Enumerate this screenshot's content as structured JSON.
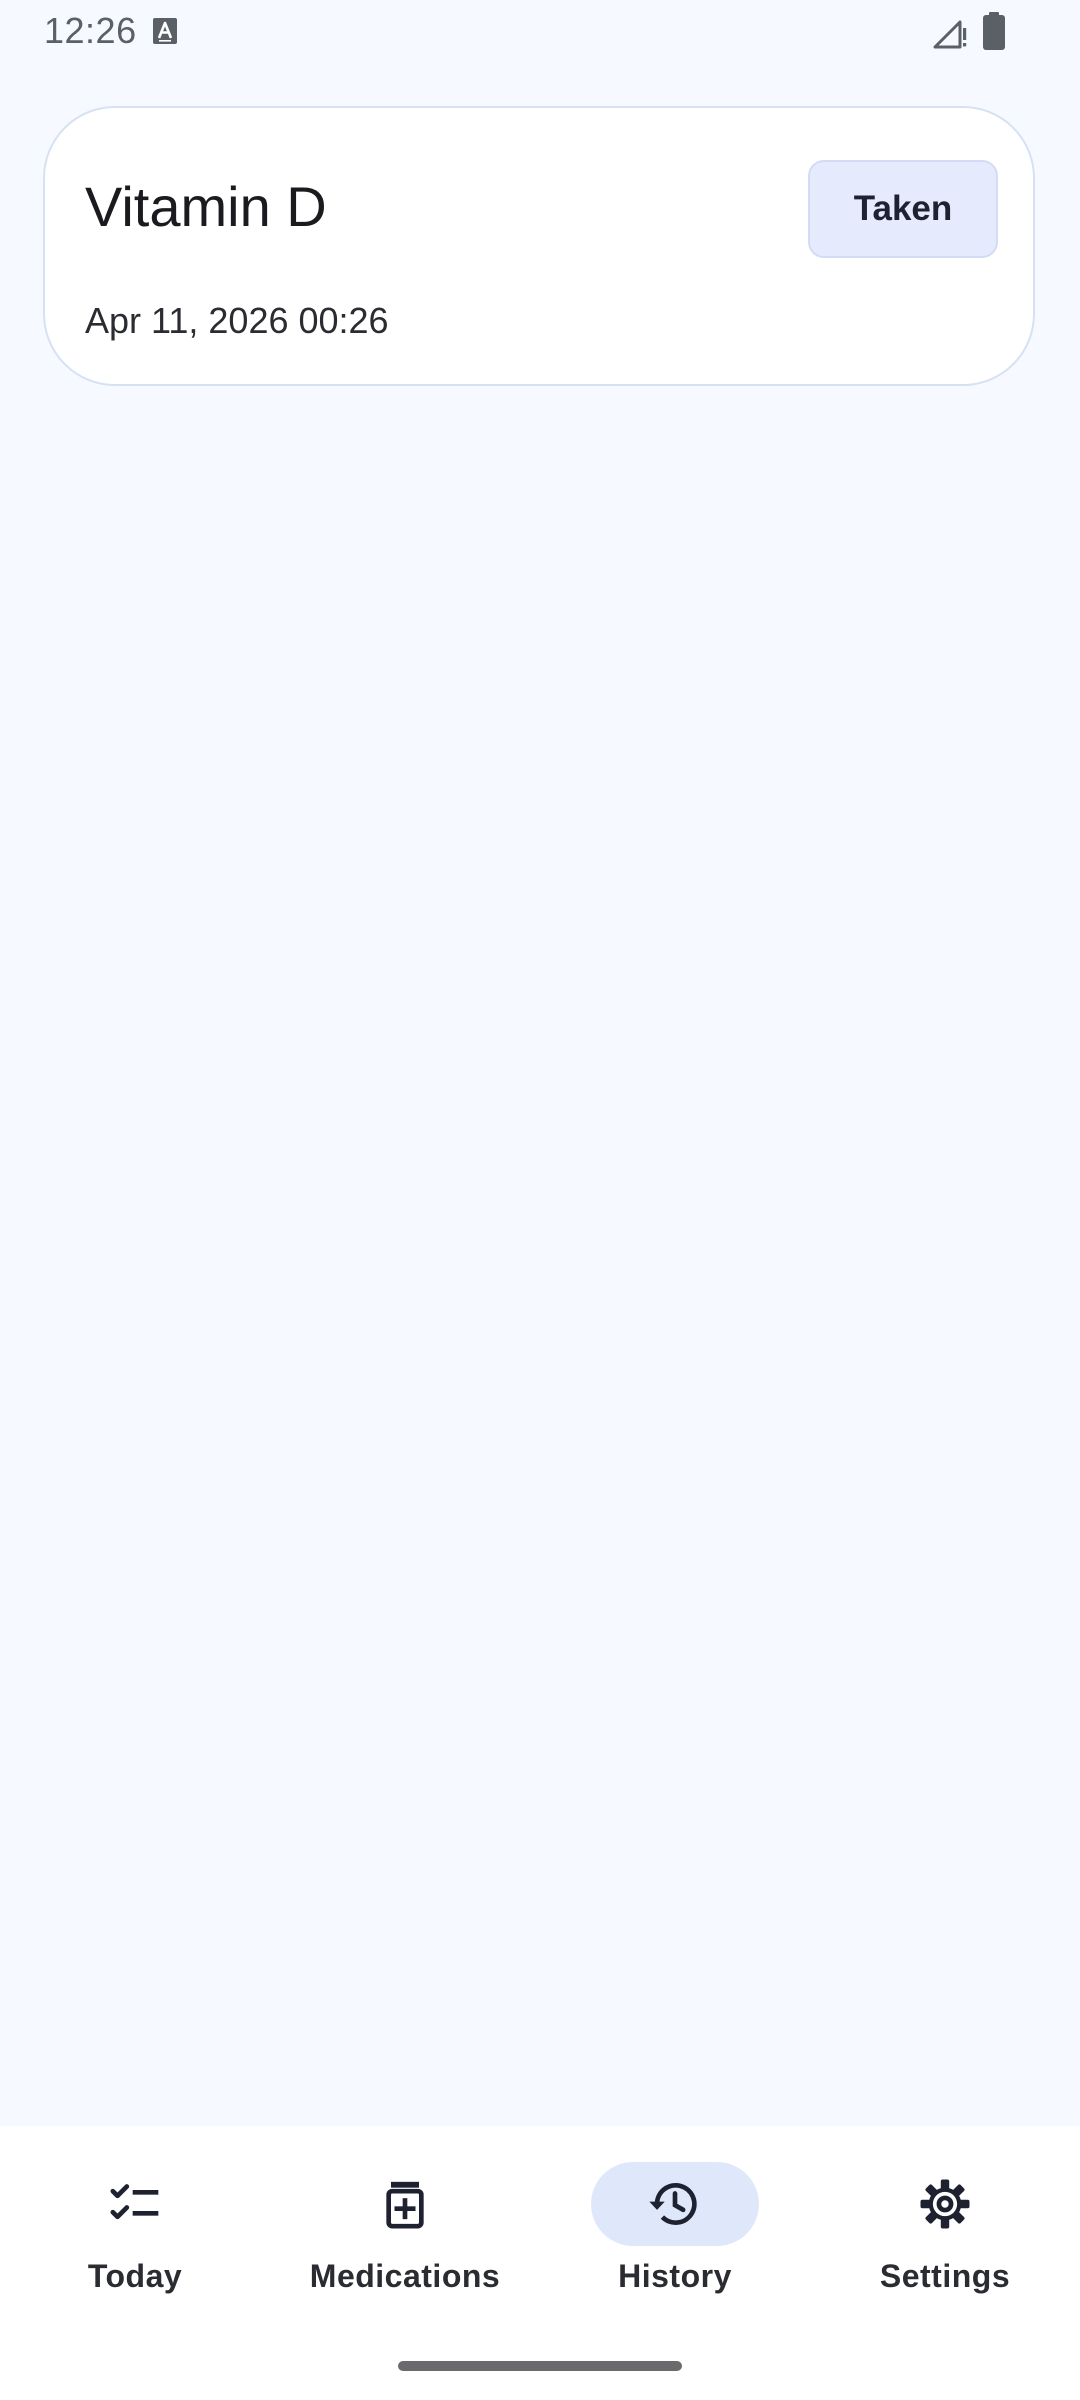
{
  "status_bar": {
    "time": "12:26",
    "notification_icon": "a-notification-icon",
    "signal_icon": "signal-icon",
    "battery_icon": "battery-icon"
  },
  "history": {
    "entries": [
      {
        "name": "Vitamin D",
        "datetime": "Apr 11, 2026 00:26",
        "status": "Taken"
      }
    ]
  },
  "nav": {
    "items": [
      {
        "label": "Today",
        "icon": "checklist-icon",
        "active": false
      },
      {
        "label": "Medications",
        "icon": "medication-icon",
        "active": false
      },
      {
        "label": "History",
        "icon": "history-icon",
        "active": true
      },
      {
        "label": "Settings",
        "icon": "gear-icon",
        "active": false
      }
    ]
  },
  "colors": {
    "background": "#f6f9ff",
    "card": "#ffffff",
    "chip": "#e5eafd",
    "nav_active": "#dfe8fb"
  }
}
